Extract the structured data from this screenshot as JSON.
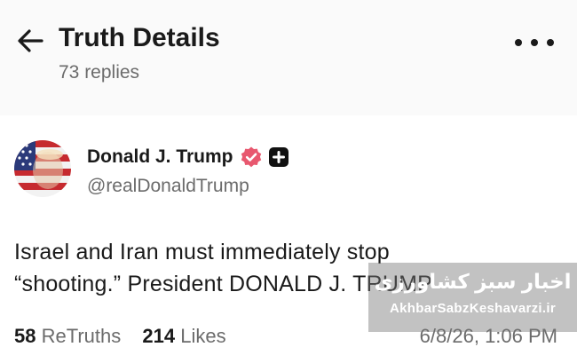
{
  "header": {
    "title": "Truth Details",
    "reply_count": "73 replies",
    "back_icon": "arrow-left-icon",
    "more_icon": "more-horizontal-icon"
  },
  "post": {
    "author_name": "Donald J. Trump",
    "author_handle": "@realDonaldTrump",
    "text_line1": "Israel and Iran must immediately stop",
    "text_line2": "“shooting.” President DONALD J. TRUMP",
    "retruths_count": "58",
    "retruths_label": "ReTruths",
    "likes_count": "214",
    "likes_label": "Likes",
    "timestamp": "6/8/26, 1:06 PM"
  },
  "watermark": {
    "persian_text": "اخبار سبز کشاورزی",
    "site": "AkhbarSabzKeshavarzi.ir"
  },
  "colors": {
    "verified_badge": "#e8586f",
    "muted_text": "#6b6b6b",
    "primary_text": "#1a1a1a"
  }
}
